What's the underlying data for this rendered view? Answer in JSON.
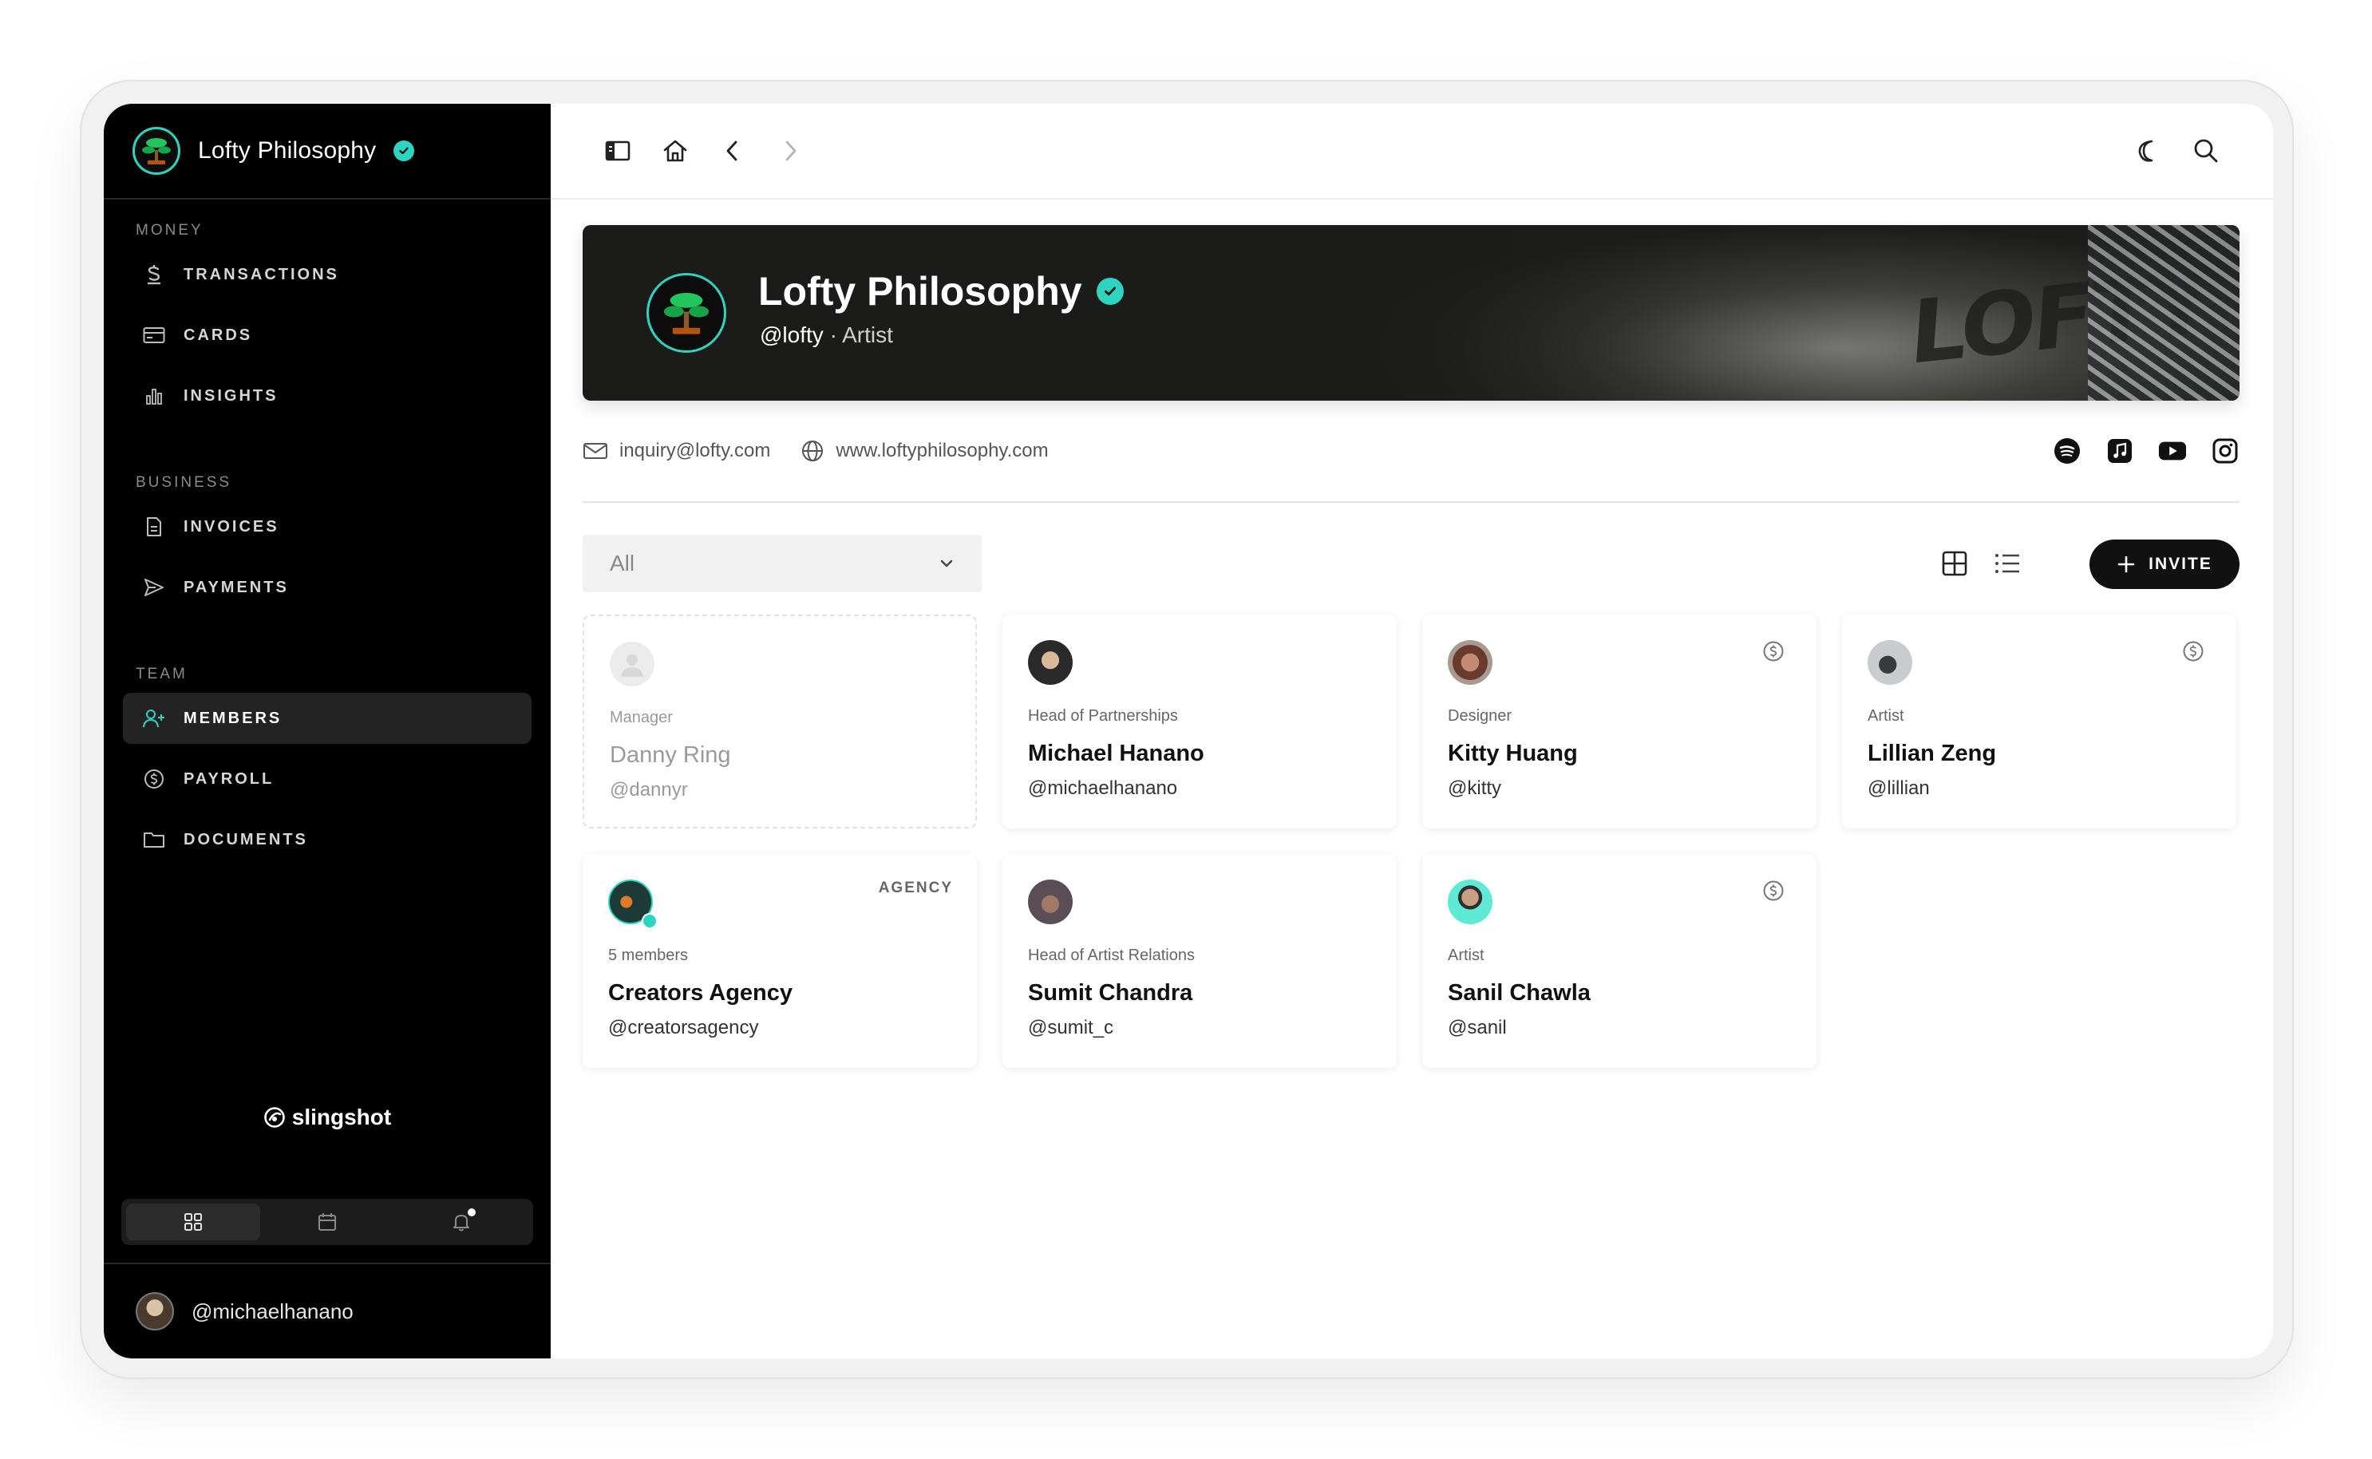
{
  "colors": {
    "accent": "#2dd4bf",
    "sidebar_bg": "#000000",
    "primary_button": "#111111"
  },
  "sidebar": {
    "org_name": "Lofty Philosophy",
    "sections": [
      {
        "label": "MONEY",
        "items": [
          {
            "label": "TRANSACTIONS",
            "icon": "dollar-icon"
          },
          {
            "label": "CARDS",
            "icon": "card-icon"
          },
          {
            "label": "INSIGHTS",
            "icon": "bar-chart-icon"
          }
        ]
      },
      {
        "label": "BUSINESS",
        "items": [
          {
            "label": "INVOICES",
            "icon": "document-icon"
          },
          {
            "label": "PAYMENTS",
            "icon": "send-icon"
          }
        ]
      },
      {
        "label": "TEAM",
        "items": [
          {
            "label": "MEMBERS",
            "icon": "user-plus-icon",
            "active": true
          },
          {
            "label": "PAYROLL",
            "icon": "payroll-icon"
          },
          {
            "label": "DOCUMENTS",
            "icon": "folder-icon"
          }
        ]
      }
    ],
    "brand": "slingshot",
    "bottom_tabs": [
      "grid-icon",
      "calendar-icon",
      "bell-icon"
    ],
    "user_handle": "@michaelhanano"
  },
  "profile": {
    "name": "Lofty Philosophy",
    "handle": "@lofty",
    "separator": "·",
    "type": "Artist",
    "banner_text": "LOFTY",
    "email": "inquiry@lofty.com",
    "website": "www.loftyphilosophy.com",
    "socials": [
      "spotify-icon",
      "apple-music-icon",
      "youtube-icon",
      "instagram-icon"
    ]
  },
  "toolbar": {
    "filter_value": "All",
    "invite_label": "INVITE"
  },
  "members": [
    {
      "role": "Manager",
      "name": "Danny Ring",
      "handle": "@dannyr",
      "pending": true
    },
    {
      "role": "Head of Partnerships",
      "name": "Michael Hanano",
      "handle": "@michaelhanano"
    },
    {
      "role": "Designer",
      "name": "Kitty Huang",
      "handle": "@kitty",
      "payroll": true
    },
    {
      "role": "Artist",
      "name": "Lillian Zeng",
      "handle": "@lillian",
      "payroll": true
    },
    {
      "role": "5 members",
      "name": "Creators Agency",
      "handle": "@creatorsagency",
      "tag": "AGENCY"
    },
    {
      "role": "Head of Artist Relations",
      "name": "Sumit Chandra",
      "handle": "@sumit_c"
    },
    {
      "role": "Artist",
      "name": "Sanil Chawla",
      "handle": "@sanil",
      "payroll": true
    }
  ]
}
